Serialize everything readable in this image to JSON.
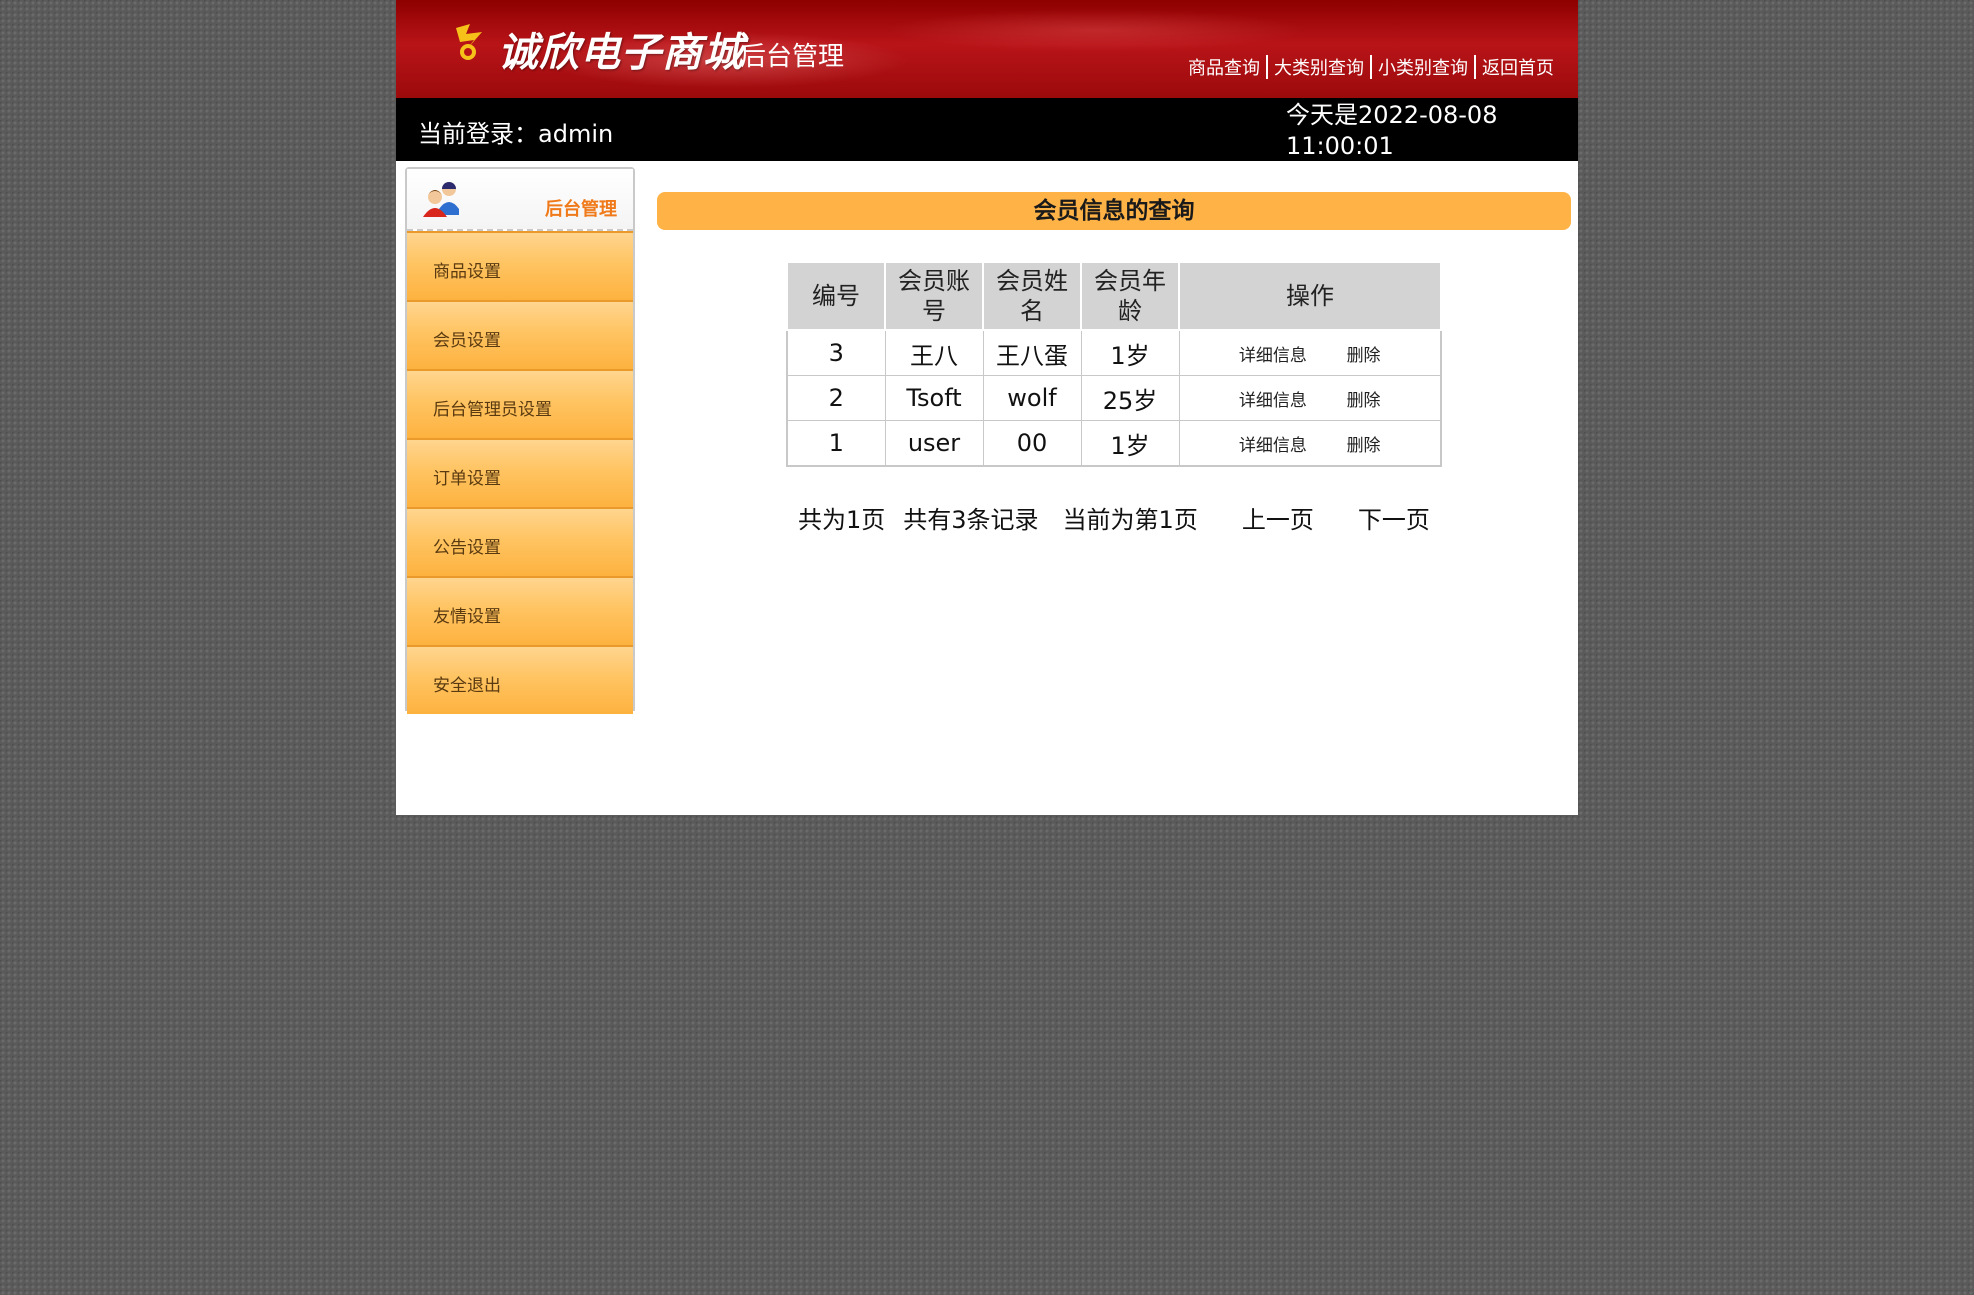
{
  "header": {
    "site_name": "诚欣电子商城",
    "site_sub": "后台管理",
    "links": [
      "商品查询",
      "大类别查询",
      "小类别查询",
      "返回首页"
    ]
  },
  "infobar": {
    "login_label": "当前登录：admin",
    "today_line1": "今天是2022-08-08",
    "today_line2": "11:00:01"
  },
  "sidebar": {
    "title": "后台管理",
    "items": [
      "商品设置",
      "会员设置",
      "后台管理员设置",
      "订单设置",
      "公告设置",
      "友情设置",
      "安全退出"
    ]
  },
  "main": {
    "title": "会员信息的查询",
    "table": {
      "headers": [
        "编号",
        "会员账号",
        "会员姓名",
        "会员年龄",
        "操作"
      ],
      "rows": [
        {
          "id": "3",
          "account": "王八",
          "name": "王八蛋",
          "age": "1岁",
          "detail": "详细信息",
          "delete": "删除"
        },
        {
          "id": "2",
          "account": "Tsoft",
          "name": "wolf",
          "age": "25岁",
          "detail": "详细信息",
          "delete": "删除"
        },
        {
          "id": "1",
          "account": "user",
          "name": "00",
          "age": "1岁",
          "detail": "详细信息",
          "delete": "删除"
        }
      ]
    },
    "pager": {
      "total_pages": "共为1页",
      "total_records": "共有3条记录",
      "current_page": "当前为第1页",
      "prev": "上一页",
      "next": "下一页"
    }
  },
  "colors": {
    "banner": "#b81418",
    "accent_orange": "#ffb347",
    "sidebar_title": "#f07a1a"
  }
}
